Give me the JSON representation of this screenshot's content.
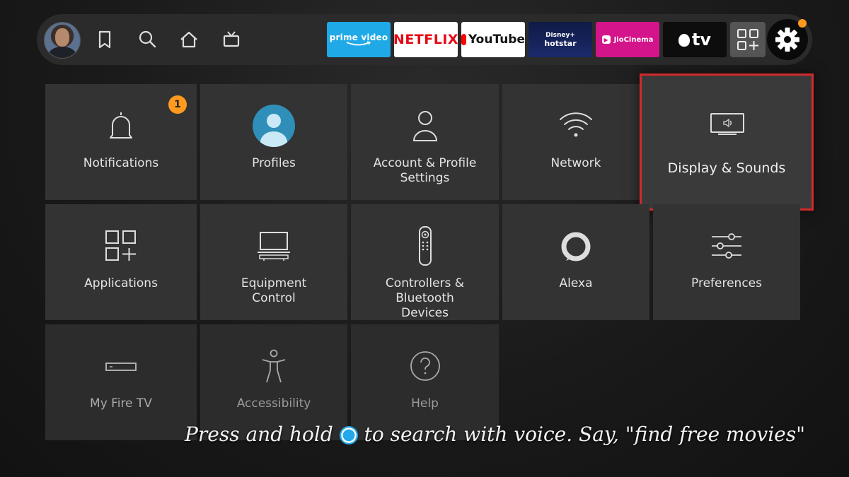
{
  "topbar": {
    "nav": [
      {
        "name": "bookmark-icon"
      },
      {
        "name": "search-icon"
      },
      {
        "name": "home-icon"
      },
      {
        "name": "live-tv-icon"
      }
    ],
    "apps": {
      "prime_video": "prime video",
      "netflix": "NETFLIX",
      "youtube": "YouTube",
      "hotstar_top": "Disney+",
      "hotstar_bottom": "hotstar",
      "jiocinema": "JioCinema",
      "appletv": "tv"
    },
    "colors": {
      "notification_dot": "#ff9a1e",
      "focus_border": "#d3292b"
    }
  },
  "tiles": {
    "notifications": {
      "label": "Notifications",
      "badge": "1"
    },
    "profiles": {
      "label": "Profiles"
    },
    "account_line1": "Account & Profile",
    "account_line2": "Settings",
    "network": {
      "label": "Network"
    },
    "display_sounds": {
      "label": "Display & Sounds"
    },
    "applications": {
      "label": "Applications"
    },
    "equipment_line1": "Equipment",
    "equipment_line2": "Control",
    "controllers_line1": "Controllers & Bluetooth",
    "controllers_line2": "Devices",
    "alexa": {
      "label": "Alexa"
    },
    "preferences": {
      "label": "Preferences"
    },
    "my_fire_tv": {
      "label": "My Fire TV"
    },
    "accessibility": {
      "label": "Accessibility"
    },
    "help": {
      "label": "Help"
    }
  },
  "hint": {
    "before": "Press and hold ",
    "after": " to search with voice. Say, \"find free movies\""
  }
}
